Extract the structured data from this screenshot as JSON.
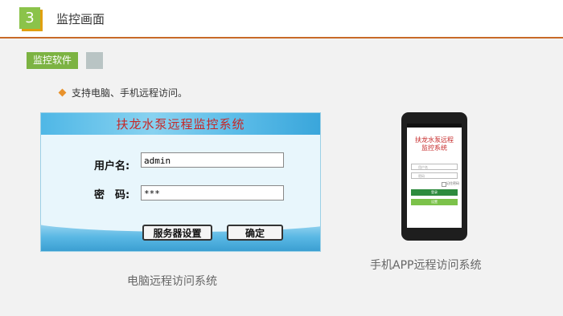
{
  "header": {
    "number": "3",
    "title": "监控画面"
  },
  "section": {
    "tag": "监控软件"
  },
  "bullet": {
    "text": "支持电脑、手机远程访问。"
  },
  "pc_login": {
    "banner_title": "扶龙水泵远程监控系统",
    "username_label": "用户名:",
    "username_value": "admin",
    "password_label": "密　码:",
    "password_value": "***",
    "server_settings_button": "服务器设置",
    "ok_button": "确定"
  },
  "phone_login": {
    "title_line1": "扶龙水泵远程",
    "title_line2": "监控系统",
    "username_placeholder": "用户名",
    "password_placeholder": "密码",
    "remember_label": "记住密码",
    "login_button": "登录",
    "settings_button": "设置"
  },
  "captions": {
    "pc": "电脑远程访问系统",
    "phone": "手机APP远程访问系统"
  },
  "colors": {
    "accent_green": "#7cb342",
    "header_line": "#c86a28",
    "banner_blue": "#4fb7e6",
    "title_red": "#c62828"
  }
}
